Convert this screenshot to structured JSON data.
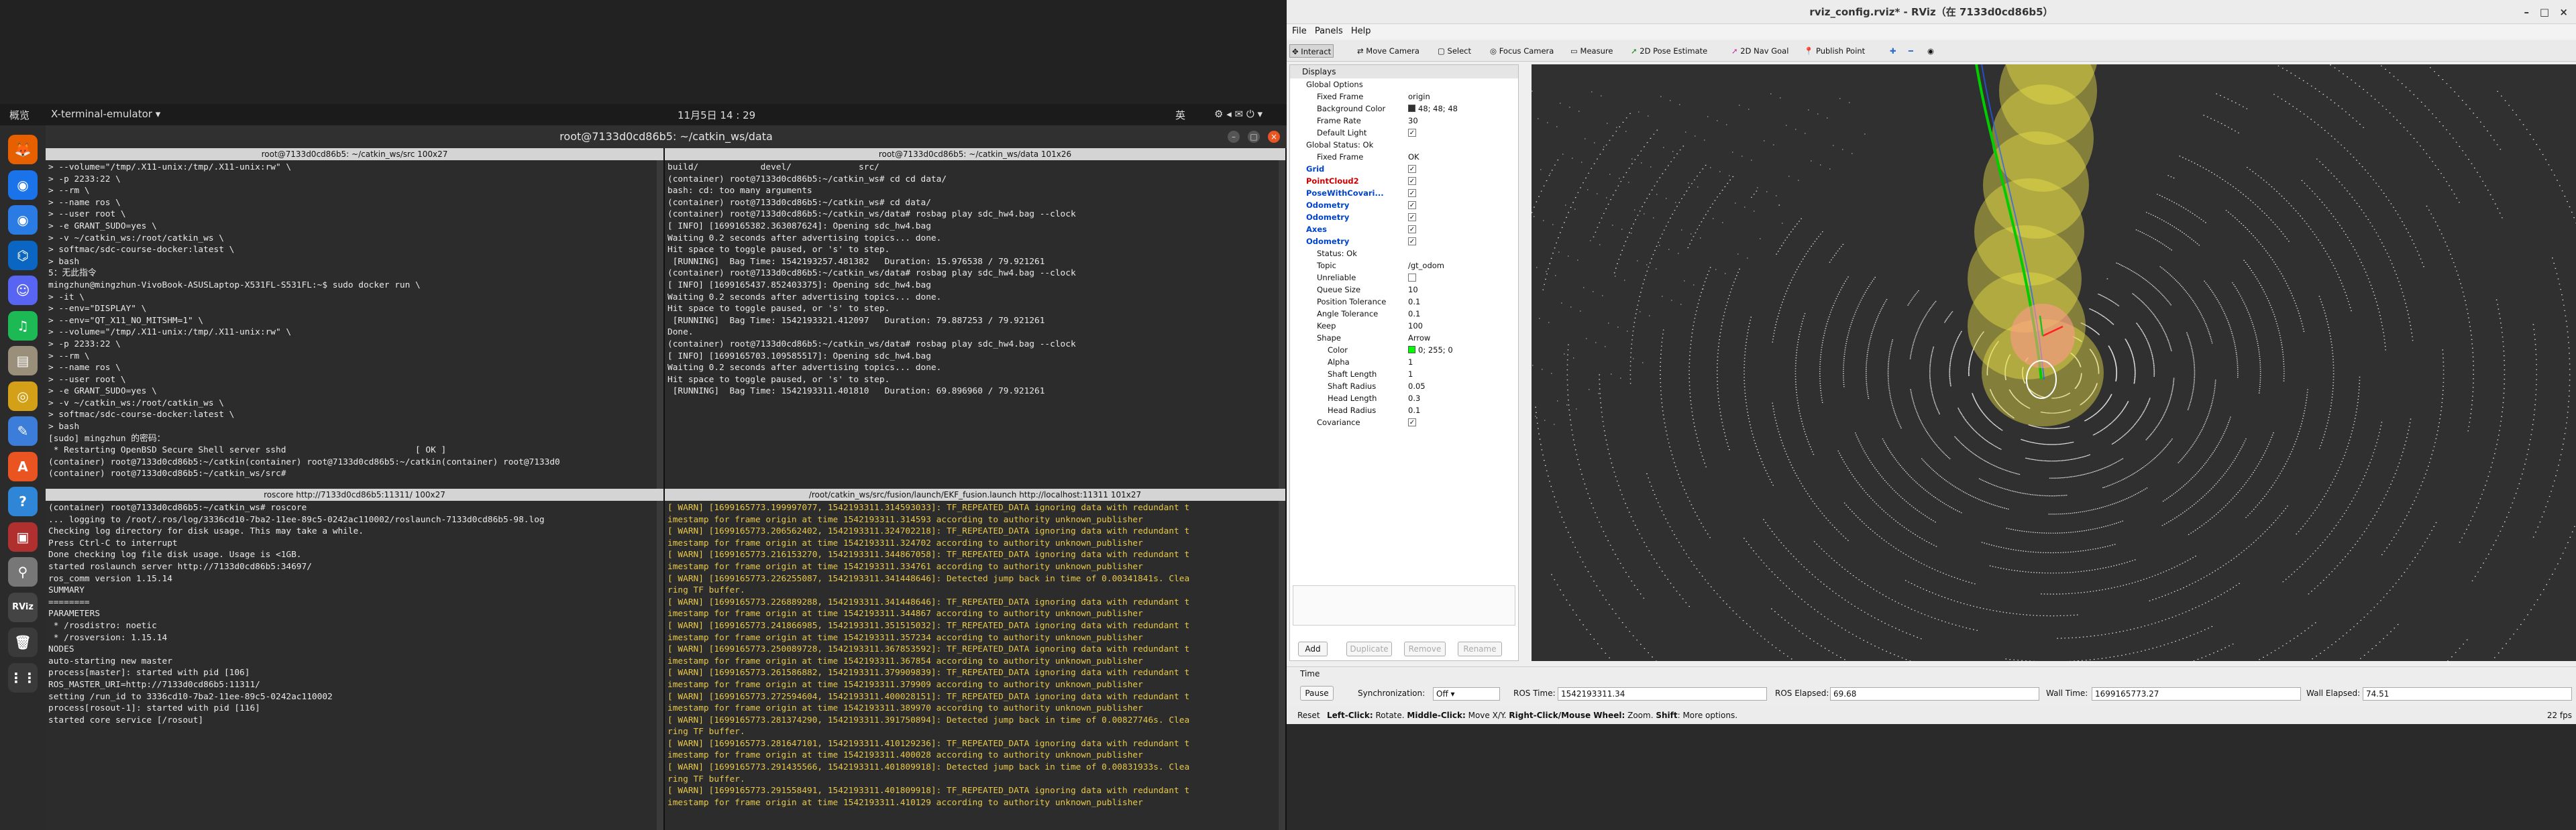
{
  "desktop": {
    "activities": "概览",
    "app_menu": "X-terminal-emulator",
    "clock": "11月5日 14 : 29",
    "ime": "英",
    "dock_apps": [
      "firefox-icon",
      "chrome-icon",
      "chromium-icon",
      "vscode-icon",
      "discord-icon",
      "spotify-icon",
      "files-icon",
      "rhythmbox-icon",
      "text-editor-icon",
      "appstore-icon",
      "help-icon",
      "terminal-icon",
      "search-icon",
      "rviz-icon",
      "trash-icon",
      "apps-grid-icon"
    ]
  },
  "terminal": {
    "window_title": "root@7133d0cd86b5: ~/catkin_ws/data",
    "panes": [
      {
        "title": "root@7133d0cd86b5: ~/catkin_ws/src 100x27",
        "lines": [
          "> --volume=\"/tmp/.X11-unix:/tmp/.X11-unix:rw\" \\",
          "> -p 2233:22 \\",
          "> --rm \\",
          "> --name ros \\",
          "> --user root \\",
          "> -e GRANT_SUDO=yes \\",
          "> -v ~/catkin_ws:/root/catkin_ws \\",
          "> softmac/sdc-course-docker:latest \\",
          "> bash",
          "5：无此指令",
          "mingzhun@mingzhun-VivoBook-ASUSLaptop-X531FL-S531FL:~$ sudo docker run \\",
          "> -it \\",
          "> --env=\"DISPLAY\" \\",
          "> --env=\"QT_X11_NO_MITSHM=1\" \\",
          "> --volume=\"/tmp/.X11-unix:/tmp/.X11-unix:rw\" \\",
          "> -p 2233:22 \\",
          "> --rm \\",
          "> --name ros \\",
          "> --user root \\",
          "> -e GRANT_SUDO=yes \\",
          "> -v ~/catkin_ws:/root/catkin_ws \\",
          "> softmac/sdc-course-docker:latest \\",
          "> bash",
          "[sudo] mingzhun 的密码：",
          " * Restarting OpenBSD Secure Shell server sshd                         [ OK ]",
          "(container) root@7133d0cd86b5:~/catkin(container) root@7133d0cd86b5:~/catkin(container) root@7133d0",
          "(container) root@7133d0cd86b5:~/catkin_ws/src# "
        ]
      },
      {
        "title": "root@7133d0cd86b5: ~/catkin_ws/data 101x26",
        "lines": [
          "build/            devel/             src/",
          "(container) root@7133d0cd86b5:~/catkin_ws# cd cd data/",
          "bash: cd: too many arguments",
          "(container) root@7133d0cd86b5:~/catkin_ws# cd data/",
          "(container) root@7133d0cd86b5:~/catkin_ws/data# rosbag play sdc_hw4.bag --clock",
          "[ INFO] [1699165382.363087624]: Opening sdc_hw4.bag",
          "",
          "Waiting 0.2 seconds after advertising topics... done.",
          "",
          "Hit space to toggle paused, or 's' to step.",
          " [RUNNING]  Bag Time: 1542193257.481382   Duration: 15.976538 / 79.921261",
          "(container) root@7133d0cd86b5:~/catkin_ws/data# rosbag play sdc_hw4.bag --clock",
          "[ INFO] [1699165437.852403375]: Opening sdc_hw4.bag",
          "",
          "Waiting 0.2 seconds after advertising topics... done.",
          "",
          "Hit space to toggle paused, or 's' to step.",
          " [RUNNING]  Bag Time: 1542193321.412097   Duration: 79.887253 / 79.921261",
          "Done.",
          "(container) root@7133d0cd86b5:~/catkin_ws/data# rosbag play sdc_hw4.bag --clock",
          "[ INFO] [1699165703.109585517]: Opening sdc_hw4.bag",
          "",
          "Waiting 0.2 seconds after advertising topics... done.",
          "",
          "Hit space to toggle paused, or 's' to step.",
          " [RUNNING]  Bag Time: 1542193311.401810   Duration: 69.896960 / 79.921261"
        ]
      },
      {
        "title": "roscore http://7133d0cd86b5:11311/ 100x27",
        "lines": [
          "(container) root@7133d0cd86b5:~/catkin_ws# roscore",
          "... logging to /root/.ros/log/3336cd10-7ba2-11ee-89c5-0242ac110002/roslaunch-7133d0cd86b5-98.log",
          "Checking log directory for disk usage. This may take a while.",
          "Press Ctrl-C to interrupt",
          "Done checking log file disk usage. Usage is <1GB.",
          "",
          "started roslaunch server http://7133d0cd86b5:34697/",
          "ros_comm version 1.15.14",
          "",
          "",
          "SUMMARY",
          "========",
          "",
          "PARAMETERS",
          " * /rosdistro: noetic",
          " * /rosversion: 1.15.14",
          "",
          "NODES",
          "",
          "auto-starting new master",
          "process[master]: started with pid [106]",
          "ROS_MASTER_URI=http://7133d0cd86b5:11311/",
          "",
          "setting /run_id to 3336cd10-7ba2-11ee-89c5-0242ac110002",
          "process[rosout-1]: started with pid [116]",
          "started core service [/rosout]"
        ]
      },
      {
        "title": "/root/catkin_ws/src/fusion/launch/EKF_fusion.launch http://localhost:11311 101x27",
        "lines": [
          "[ WARN] [1699165773.199997077, 1542193311.314593033]: TF_REPEATED_DATA ignoring data with redundant t",
          "imestamp for frame origin at time 1542193311.314593 according to authority unknown_publisher",
          "[ WARN] [1699165773.206562402, 1542193311.324702218]: TF_REPEATED_DATA ignoring data with redundant t",
          "imestamp for frame origin at time 1542193311.324702 according to authority unknown_publisher",
          "[ WARN] [1699165773.216153270, 1542193311.344867058]: TF_REPEATED_DATA ignoring data with redundant t",
          "imestamp for frame origin at time 1542193311.334761 according to authority unknown_publisher",
          "[ WARN] [1699165773.226255087, 1542193311.341448646]: Detected jump back in time of 0.00341841s. Clea",
          "ring TF buffer.",
          "[ WARN] [1699165773.226889288, 1542193311.341448646]: TF_REPEATED_DATA ignoring data with redundant t",
          "imestamp for frame origin at time 1542193311.344867 according to authority unknown_publisher",
          "[ WARN] [1699165773.241866985, 1542193311.351515032]: TF_REPEATED_DATA ignoring data with redundant t",
          "imestamp for frame origin at time 1542193311.357234 according to authority unknown_publisher",
          "[ WARN] [1699165773.250089728, 1542193311.367853592]: TF_REPEATED_DATA ignoring data with redundant t",
          "imestamp for frame origin at time 1542193311.367854 according to authority unknown_publisher",
          "[ WARN] [1699165773.261586882, 1542193311.379909839]: TF_REPEATED_DATA ignoring data with redundant t",
          "imestamp for frame origin at time 1542193311.379909 according to authority unknown_publisher",
          "[ WARN] [1699165773.272594604, 1542193311.400028151]: TF_REPEATED_DATA ignoring data with redundant t",
          "imestamp for frame origin at time 1542193311.389970 according to authority unknown_publisher",
          "[ WARN] [1699165773.281374290, 1542193311.391750894]: Detected jump back in time of 0.00827746s. Clea",
          "ring TF buffer.",
          "[ WARN] [1699165773.281647101, 1542193311.410129236]: TF_REPEATED_DATA ignoring data with redundant t",
          "imestamp for frame origin at time 1542193311.400028 according to authority unknown_publisher",
          "[ WARN] [1699165773.291435566, 1542193311.401809918]: Detected jump back in time of 0.00831933s. Clea",
          "ring TF buffer.",
          "[ WARN] [1699165773.291558491, 1542193311.401809918]: TF_REPEATED_DATA ignoring data with redundant t",
          "imestamp for frame origin at time 1542193311.410129 according to authority unknown_publisher"
        ]
      }
    ]
  },
  "rviz": {
    "title": "rviz_config.rviz* - RViz（在 7133d0cd86b5）",
    "menu": [
      "File",
      "Panels",
      "Help"
    ],
    "tools": [
      "Interact",
      "Move Camera",
      "Select",
      "Focus Camera",
      "Measure",
      "2D Pose Estimate",
      "2D Nav Goal",
      "Publish Point"
    ],
    "displays_header": "Displays",
    "rows": [
      {
        "k": "Global Options",
        "v": "",
        "ind": 1,
        "st": ""
      },
      {
        "k": "Fixed Frame",
        "v": "origin",
        "ind": 2,
        "st": ""
      },
      {
        "k": "Background Color",
        "v": "48; 48; 48",
        "ind": 2,
        "st": "",
        "sw": "#303030"
      },
      {
        "k": "Frame Rate",
        "v": "30",
        "ind": 2,
        "st": ""
      },
      {
        "k": "Default Light",
        "v": "✓",
        "ind": 2,
        "st": "cb"
      },
      {
        "k": "Global Status: Ok",
        "v": "",
        "ind": 1,
        "st": ""
      },
      {
        "k": "Fixed Frame",
        "v": "OK",
        "ind": 2,
        "st": ""
      },
      {
        "k": "Grid",
        "v": "✓",
        "ind": 1,
        "st": "cb",
        "c": "blue"
      },
      {
        "k": "PointCloud2",
        "v": "✓",
        "ind": 1,
        "st": "cb",
        "c": "red"
      },
      {
        "k": "PoseWithCovari...",
        "v": "✓",
        "ind": 1,
        "st": "cb",
        "c": "blue"
      },
      {
        "k": "Odometry",
        "v": "✓",
        "ind": 1,
        "st": "cb",
        "c": "blue"
      },
      {
        "k": "Odometry",
        "v": "✓",
        "ind": 1,
        "st": "cb",
        "c": "blue"
      },
      {
        "k": "Axes",
        "v": "✓",
        "ind": 1,
        "st": "cb",
        "c": "blue"
      },
      {
        "k": "Odometry",
        "v": "✓",
        "ind": 1,
        "st": "cb",
        "c": "blue"
      },
      {
        "k": "Status: Ok",
        "v": "",
        "ind": 2,
        "st": ""
      },
      {
        "k": "Topic",
        "v": "/gt_odom",
        "ind": 2,
        "st": ""
      },
      {
        "k": "Unreliable",
        "v": "",
        "ind": 2,
        "st": "cb0"
      },
      {
        "k": "Queue Size",
        "v": "10",
        "ind": 2,
        "st": ""
      },
      {
        "k": "Position Tolerance",
        "v": "0.1",
        "ind": 2,
        "st": ""
      },
      {
        "k": "Angle Tolerance",
        "v": "0.1",
        "ind": 2,
        "st": ""
      },
      {
        "k": "Keep",
        "v": "100",
        "ind": 2,
        "st": ""
      },
      {
        "k": "Shape",
        "v": "Arrow",
        "ind": 2,
        "st": ""
      },
      {
        "k": "Color",
        "v": "0; 255; 0",
        "ind": 3,
        "st": "",
        "sw": "#00ff00"
      },
      {
        "k": "Alpha",
        "v": "1",
        "ind": 3,
        "st": ""
      },
      {
        "k": "Shaft Length",
        "v": "1",
        "ind": 3,
        "st": ""
      },
      {
        "k": "Shaft Radius",
        "v": "0.05",
        "ind": 3,
        "st": ""
      },
      {
        "k": "Head Length",
        "v": "0.3",
        "ind": 3,
        "st": ""
      },
      {
        "k": "Head Radius",
        "v": "0.1",
        "ind": 3,
        "st": ""
      },
      {
        "k": "Covariance",
        "v": "✓",
        "ind": 2,
        "st": "cb"
      }
    ],
    "buttons": {
      "add": "Add",
      "duplicate": "Duplicate",
      "remove": "Remove",
      "rename": "Rename"
    },
    "time": {
      "panel": "Time",
      "pause": "Pause",
      "sync_label": "Synchronization:",
      "sync": "Off",
      "ros_time_label": "ROS Time:",
      "ros_time": "1542193311.34",
      "ros_elapsed_label": "ROS Elapsed:",
      "ros_elapsed": "69.68",
      "wall_time_label": "Wall Time:",
      "wall_time": "1699165773.27",
      "wall_elapsed_label": "Wall Elapsed:",
      "wall_elapsed": "74.51"
    },
    "status": {
      "reset": "Reset",
      "hint1": "Left-Click:",
      "hint1t": " Rotate. ",
      "hint2": "Middle-Click:",
      "hint2t": " Move X/Y. ",
      "hint3": "Right-Click/Mouse Wheel:",
      "hint3t": " Zoom. ",
      "hint4": "Shift",
      "hint4t": ": More options.",
      "fps": "22 fps"
    },
    "colors": {
      "pointcloud": "#ffffff",
      "covariance": "#e8e04a",
      "odometry_path": "#00cc00",
      "pose_ellipse": "#ff9a8a"
    }
  }
}
